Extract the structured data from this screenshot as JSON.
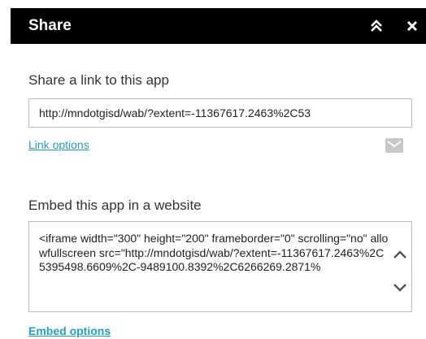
{
  "panel": {
    "title": "Share",
    "collapse_icon": "double-chevron-up-icon",
    "close_icon": "close-icon"
  },
  "link_section": {
    "label": "Share a link to this app",
    "url": "http://mndotgisd/wab/?extent=-11367617.2463%2C53",
    "options_label": "Link options",
    "mail_icon": "mail-icon"
  },
  "embed_section": {
    "label": "Embed this app in a website",
    "code": "<iframe width=\"300\" height=\"200\" frameborder=\"0\" scrolling=\"no\" allowfullscreen src=\"http://mndotgisd/wab/?extent=-11367617.2463%2C5395498.6609%2C-9489100.8392%2C6266269.2871%",
    "options_label": "Embed options"
  },
  "colors": {
    "titlebar": "#000000",
    "link": "#1fa0c4",
    "border": "#bdbdbd"
  }
}
